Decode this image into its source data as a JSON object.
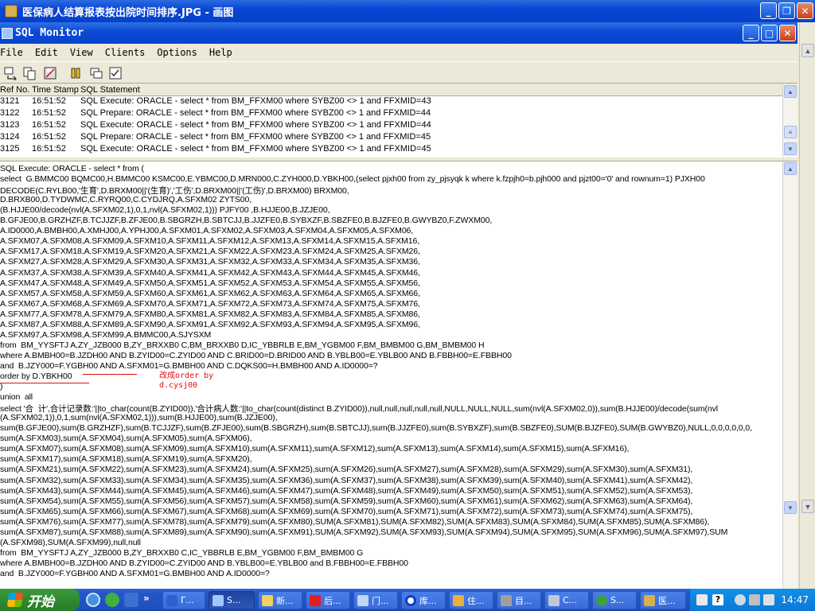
{
  "outer_window": {
    "title": "医保病人结算报表按出院时间排序.JPG - 画图"
  },
  "inner_window": {
    "title": "SQL Monitor"
  },
  "menu": [
    "File",
    "Edit",
    "View",
    "Clients",
    "Options",
    "Help"
  ],
  "log": {
    "columns": [
      "Ref No.",
      "Time Stamp",
      "SQL Statement"
    ],
    "rows": [
      {
        "ref": "3121",
        "time": "16:51:52",
        "stmt": "SQL Execute: ORACLE - select  *  from  BM_FFXM00  where  SYBZ00 <> 1  and  FFXMID=43"
      },
      {
        "ref": "3122",
        "time": "16:51:52",
        "stmt": "SQL Prepare: ORACLE - select  *  from  BM_FFXM00  where  SYBZ00 <> 1  and  FFXMID=44"
      },
      {
        "ref": "3123",
        "time": "16:51:52",
        "stmt": "SQL Execute: ORACLE - select  *  from  BM_FFXM00  where  SYBZ00 <> 1  and  FFXMID=44"
      },
      {
        "ref": "3124",
        "time": "16:51:52",
        "stmt": "SQL Prepare: ORACLE - select  *  from  BM_FFXM00  where  SYBZ00 <> 1  and  FFXMID=45"
      },
      {
        "ref": "3125",
        "time": "16:51:52",
        "stmt": "SQL Execute: ORACLE - select  *  from  BM_FFXM00  where  SYBZ00 <> 1  and  FFXMID=45"
      }
    ]
  },
  "sql_lines": [
    "SQL Execute: ORACLE - select * from (",
    "select  G.BMMC00 BQMC00,H.BMMC00 KSMC00,E.YBMC00,D.MRN000,C.ZYH000,D.YBKH00,(select pjxh00 from zy_pjsyqk k where k.fzpjh0=b.pjh000 and pjzt00='0' and rownum=1) PJXH00",
    "DECODE(C.RYLB00,'生育',D.BRXM00||'(生育)','工伤',D.BRXM00||'(工伤)',D.BRXM00) BRXM00,",
    "D.BRXB00,D.TYDWMC,C.RYRQ00,C.CYDJRQ,A.SFXM02 ZYTS00,",
    "(B.HJJE00/decode(nvl(A.SFXM02,1),0,1,nvl(A.SFXM02,1))) PJFY00 ,B.HJJE00,B.JZJE00,",
    "B.GFJE00,B.GRZHZF,B.TCJJZF,B.ZFJE00,B.SBGRZH,B.SBTCJJ,B.JJZFE0,B.SYBXZF,B.SBZFE0,B.BJZFE0,B.GWYBZ0,F.ZWXM00,",
    "A.ID0000,A.BMBH00,A.XMHJ00,A.YPHJ00,A.SFXM01,A.SFXM02,A.SFXM03,A.SFXM04,A.SFXM05,A.SFXM06,",
    "A.SFXM07,A.SFXM08,A.SFXM09,A.SFXM10,A.SFXM11,A.SFXM12,A.SFXM13,A.SFXM14,A.SFXM15,A.SFXM16,",
    "A.SFXM17,A.SFXM18,A.SFXM19,A.SFXM20,A.SFXM21,A.SFXM22,A.SFXM23,A.SFXM24,A.SFXM25,A.SFXM26,",
    "A.SFXM27,A.SFXM28,A.SFXM29,A.SFXM30,A.SFXM31,A.SFXM32,A.SFXM33,A.SFXM34,A.SFXM35,A.SFXM36,",
    "A.SFXM37,A.SFXM38,A.SFXM39,A.SFXM40,A.SFXM41,A.SFXM42,A.SFXM43,A.SFXM44,A.SFXM45,A.SFXM46,",
    "A.SFXM47,A.SFXM48,A.SFXM49,A.SFXM50,A.SFXM51,A.SFXM52,A.SFXM53,A.SFXM54,A.SFXM55,A.SFXM56,",
    "A.SFXM57,A.SFXM58,A.SFXM59,A.SFXM60,A.SFXM61,A.SFXM62,A.SFXM63,A.SFXM64,A.SFXM65,A.SFXM66,",
    "A.SFXM67,A.SFXM68,A.SFXM69,A.SFXM70,A.SFXM71,A.SFXM72,A.SFXM73,A.SFXM74,A.SFXM75,A.SFXM76,",
    "A.SFXM77,A.SFXM78,A.SFXM79,A.SFXM80,A.SFXM81,A.SFXM82,A.SFXM83,A.SFXM84,A.SFXM85,A.SFXM86,",
    "A.SFXM87,A.SFXM88,A.SFXM89,A.SFXM90,A.SFXM91,A.SFXM92,A.SFXM93,A.SFXM94,A.SFXM95,A.SFXM96,",
    "A.SFXM97,A.SFXM98,A.SFXM99,A.BMMC00,A.SJYSXM",
    "from  BM_YYSFTJ A,ZY_JZB000 B,ZY_BRXXB0 C,BM_BRXXB0 D,IC_YBBRLB E,BM_YGBM00 F,BM_BMBM00 G,BM_BMBM00 H",
    "where A.BMBH00=B.JZDH00 AND B.ZYID00=C.ZYID00 AND C.BRID00=D.BRID00 AND B.YBLB00=E.YBLB00 AND B.FBBH00=E.FBBH00",
    "and  B.JZY000=F.YGBH00 AND A.SFXM01=G.BMBH00 AND C.DQKS00=H.BMBH00 AND A.ID0000=?",
    "order by D.YBKH00",
    ")",
    "union  all",
    "select '合  计',合计记录数:'||to_char(count(B.ZYID00)),'合计病人数:'||to_char(count(distinct B.ZYID00)),null,null,null,null,null,NULL,NULL,NULL,sum(nvl(A.SFXM02,0)),sum(B.HJJE00)/decode(sum(nvl",
    "(A.SFXM02,1)),0,1,sum(nvl(A.SFXM02,1))),sum(B.HJJE00),sum(B.JZJE00),",
    "sum(B.GFJE00),sum(B.GRZHZF),sum(B.TCJJZF),sum(B.ZFJE00),sum(B.SBGRZH),sum(B.SBTCJJ),sum(B.JJZFE0),sum(B.SYBXZF),sum(B.SBZFE0),SUM(B.BJZFE0),SUM(B.GWYBZ0),NULL,0,0,0,0,0,0,",
    "sum(A.SFXM03),sum(A.SFXM04),sum(A.SFXM05),sum(A.SFXM06),",
    "sum(A.SFXM07),sum(A.SFXM08),sum(A.SFXM09),sum(A.SFXM10),sum(A.SFXM11),sum(A.SFXM12),sum(A.SFXM13),sum(A.SFXM14),sum(A.SFXM15),sum(A.SFXM16),",
    "sum(A.SFXM17),sum(A.SFXM18),sum(A.SFXM19),sum(A.SFXM20),",
    "sum(A.SFXM21),sum(A.SFXM22),sum(A.SFXM23),sum(A.SFXM24),sum(A.SFXM25),sum(A.SFXM26),sum(A.SFXM27),sum(A.SFXM28),sum(A.SFXM29),sum(A.SFXM30),sum(A.SFXM31),",
    "sum(A.SFXM32),sum(A.SFXM33),sum(A.SFXM34),sum(A.SFXM35),sum(A.SFXM36),sum(A.SFXM37),sum(A.SFXM38),sum(A.SFXM39),sum(A.SFXM40),sum(A.SFXM41),sum(A.SFXM42),",
    "sum(A.SFXM43),sum(A.SFXM44),sum(A.SFXM45),sum(A.SFXM46),sum(A.SFXM47),sum(A.SFXM48),sum(A.SFXM49),sum(A.SFXM50),sum(A.SFXM51),sum(A.SFXM52),sum(A.SFXM53),",
    "sum(A.SFXM54),sum(A.SFXM55),sum(A.SFXM56),sum(A.SFXM57),sum(A.SFXM58),sum(A.SFXM59),sum(A.SFXM60),sum(A.SFXM61),sum(A.SFXM62),sum(A.SFXM63),sum(A.SFXM64),",
    "sum(A.SFXM65),sum(A.SFXM66),sum(A.SFXM67),sum(A.SFXM68),sum(A.SFXM69),sum(A.SFXM70),sum(A.SFXM71),sum(A.SFXM72),sum(A.SFXM73),sum(A.SFXM74),sum(A.SFXM75),",
    "sum(A.SFXM76),sum(A.SFXM77),sum(A.SFXM78),sum(A.SFXM79),sum(A.SFXM80),SUM(A.SFXM81),SUM(A.SFXM82),SUM(A.SFXM83),SUM(A.SFXM84),SUM(A.SFXM85),SUM(A.SFXM86),",
    "sum(A.SFXM87),sum(A.SFXM88),sum(A.SFXM89),sum(A.SFXM90),sum(A.SFXM91),SUM(A.SFXM92),SUM(A.SFXM93),SUM(A.SFXM94),SUM(A.SFXM95),SUM(A.SFXM96),SUM(A.SFXM97),SUM",
    "(A.SFXM98),SUM(A.SFXM99),null,null",
    "from  BM_YYSFTJ A,ZY_JZB000 B,ZY_BRXXB0 C,IC_YBBRLB E,BM_YGBM00 F,BM_BMBM00 G",
    "where A.BMBH00=B.JZDH00 AND B.ZYID00=C.ZYID00 AND B.YBLB00=E.YBLB00 and B.FBBH00=E.FBBH00",
    "and  B.JZY000=F.YGBH00 AND A.SFXM01=G.BMBH00 AND A.ID0000=?"
  ],
  "annotation": {
    "line1": "改成order by",
    "line2": "d.cysj00"
  },
  "taskbar": {
    "start_label": "开始",
    "tasks": [
      "Γ...",
      "S...",
      "新...",
      "后...",
      "门...",
      "库...",
      "住...",
      "目...",
      "C...",
      "S...",
      "医..."
    ],
    "clock": "14:47"
  },
  "colors": {
    "title_blue": "#0a46d6",
    "taskbar_blue": "#2456c8",
    "start_green": "#2f8a2f",
    "annotation_red": "#e01010"
  }
}
